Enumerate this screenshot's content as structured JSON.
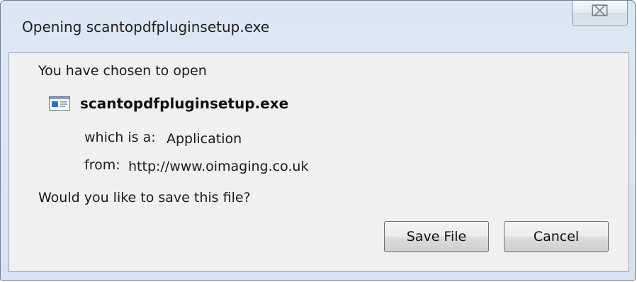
{
  "window": {
    "title": "Opening scantopdfpluginsetup.exe",
    "close_glyph": "⌧"
  },
  "dialog": {
    "intro": "You have chosen to open",
    "file_name": "scantopdfpluginsetup.exe",
    "file_icon": "application-window-icon",
    "which_is_label": "which is a:",
    "which_is_value": "Application",
    "from_label": "from:",
    "from_value": "http://www.oimaging.co.uk",
    "question": "Would you like to save this file?"
  },
  "buttons": {
    "save": "Save File",
    "cancel": "Cancel"
  },
  "colors": {
    "title_bar": "#dbe6f3",
    "client_background": "#f0f0f0",
    "icon_blue": "#2f6fc4"
  }
}
